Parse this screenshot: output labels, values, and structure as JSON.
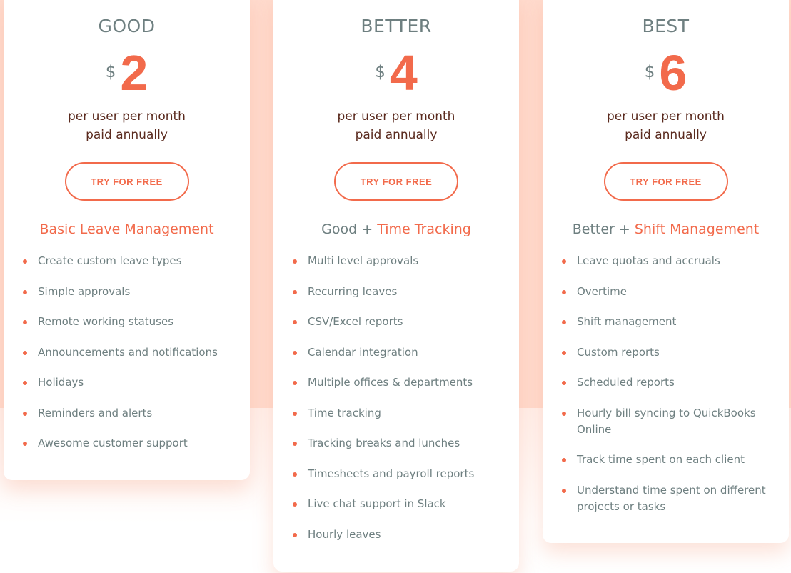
{
  "colors": {
    "accent": "#F26A4B",
    "muted_text": "#6E7F80",
    "billing_text": "#5A2A1E",
    "background_band": "#FFDCCF",
    "card": "#FFFFFF"
  },
  "plans": [
    {
      "name": "GOOD",
      "currency": "$",
      "price": "2",
      "billing_line1": "per user per month",
      "billing_line2": "paid annually",
      "cta_label": "TRY FOR FREE",
      "heading_prefix": "",
      "heading_accent": "Basic Leave Management",
      "features": [
        "Create custom leave types",
        "Simple approvals",
        "Remote working statuses",
        "Announcements and notifications",
        "Holidays",
        "Reminders and alerts",
        "Awesome customer support"
      ]
    },
    {
      "name": "BETTER",
      "currency": "$",
      "price": "4",
      "billing_line1": "per user per month",
      "billing_line2": "paid annually",
      "cta_label": "TRY FOR FREE",
      "heading_prefix": "Good + ",
      "heading_accent": "Time Tracking",
      "features": [
        "Multi level approvals",
        "Recurring leaves",
        "CSV/Excel reports",
        "Calendar integration",
        "Multiple offices & departments",
        "Time tracking",
        "Tracking breaks and lunches",
        "Timesheets and payroll reports",
        "Live chat support in Slack",
        "Hourly leaves"
      ]
    },
    {
      "name": "BEST",
      "currency": "$",
      "price": "6",
      "billing_line1": "per user per month",
      "billing_line2": "paid annually",
      "cta_label": "TRY FOR FREE",
      "heading_prefix": "Better + ",
      "heading_accent": "Shift Management",
      "features": [
        "Leave quotas and accruals",
        "Overtime",
        "Shift management",
        "Custom reports",
        "Scheduled reports",
        "Hourly bill syncing to QuickBooks Online",
        "Track time spent on each client",
        "Understand time spent on different projects or tasks"
      ]
    }
  ]
}
